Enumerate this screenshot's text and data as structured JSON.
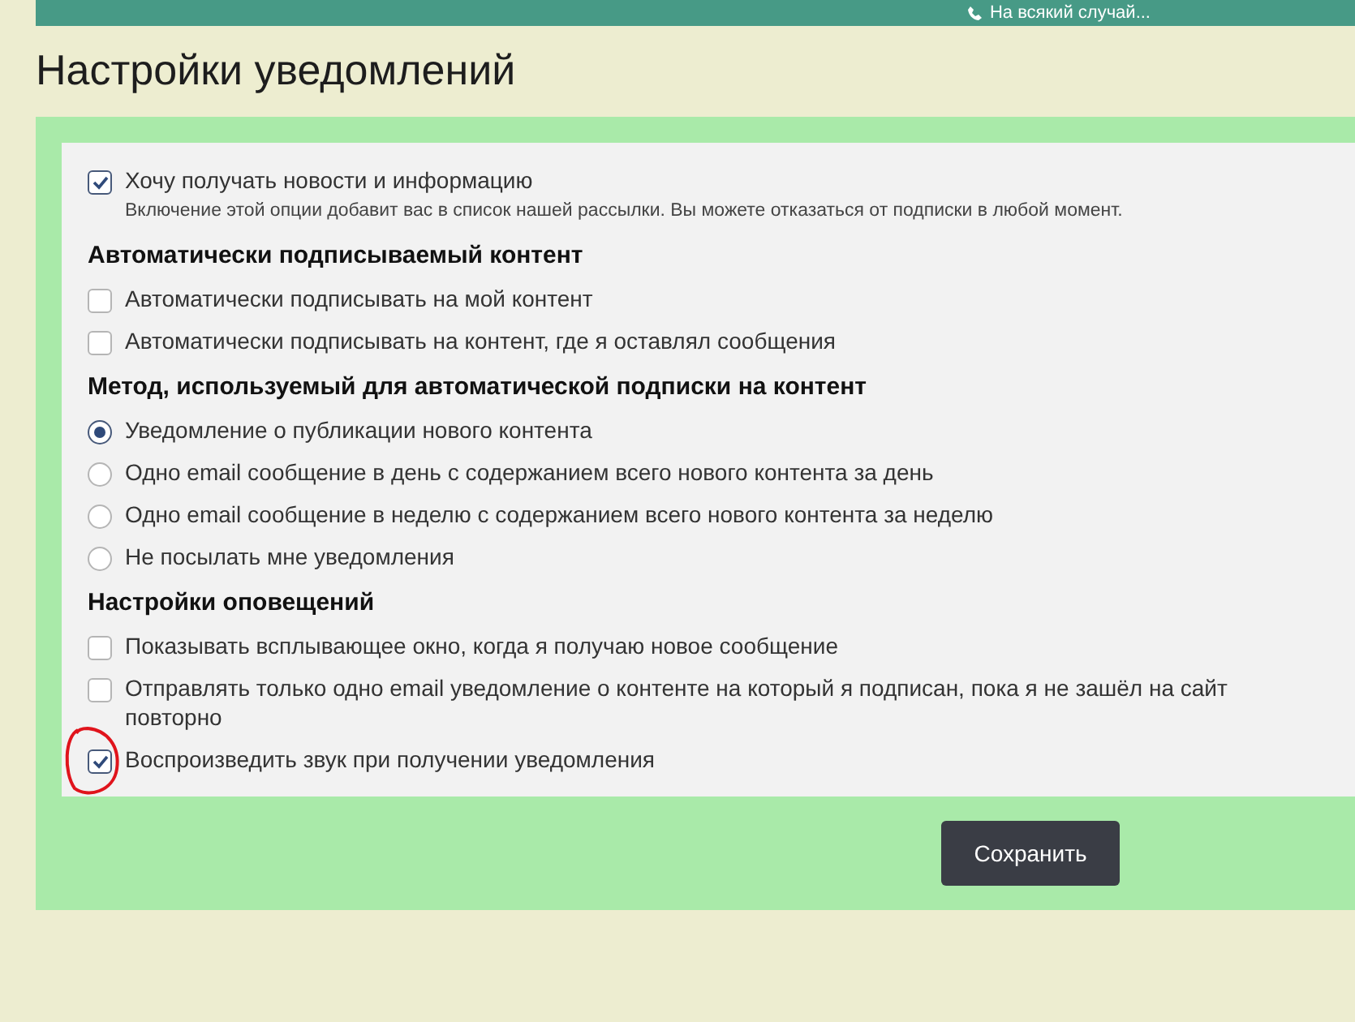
{
  "top_bar": {
    "link": "На всякий случай..."
  },
  "title": "Настройки уведомлений",
  "sections": [
    {
      "items": [
        {
          "kind": "checkbox",
          "label": "Хочу получать новости и информацию",
          "hint": "Включение этой опции добавит вас в список нашей рассылки. Вы можете отказаться от подписки в любой момент.",
          "checked": true
        }
      ]
    },
    {
      "heading": "Автоматически подписываемый контент",
      "items": [
        {
          "kind": "checkbox",
          "label": "Автоматически подписывать на мой контент",
          "checked": false
        },
        {
          "kind": "checkbox",
          "label": "Автоматически подписывать на контент, где я оставлял сообщения",
          "checked": false
        }
      ]
    },
    {
      "heading": "Метод, используемый для автоматической подписки на контент",
      "items": [
        {
          "kind": "radio",
          "label": "Уведомление о публикации нового контента",
          "selected": true
        },
        {
          "kind": "radio",
          "label": "Одно email сообщение в день с содержанием всего нового контента за день",
          "selected": false
        },
        {
          "kind": "radio",
          "label": "Одно email сообщение в неделю с содержанием всего нового контента за неделю",
          "selected": false
        },
        {
          "kind": "radio",
          "label": "Не посылать мне уведомления",
          "selected": false
        }
      ]
    },
    {
      "heading": "Настройки оповещений",
      "items": [
        {
          "kind": "checkbox",
          "label": "Показывать всплывающее окно, когда я получаю новое сообщение",
          "checked": false
        },
        {
          "kind": "checkbox",
          "label": "Отправлять только одно email уведомление о контенте на который я подписан, пока я не зашёл на сайт повторно",
          "checked": false
        },
        {
          "kind": "checkbox",
          "label": "Воспроизведить звук при получении уведомления",
          "checked": true,
          "annotated": true
        }
      ]
    }
  ],
  "save_button": "Сохранить"
}
